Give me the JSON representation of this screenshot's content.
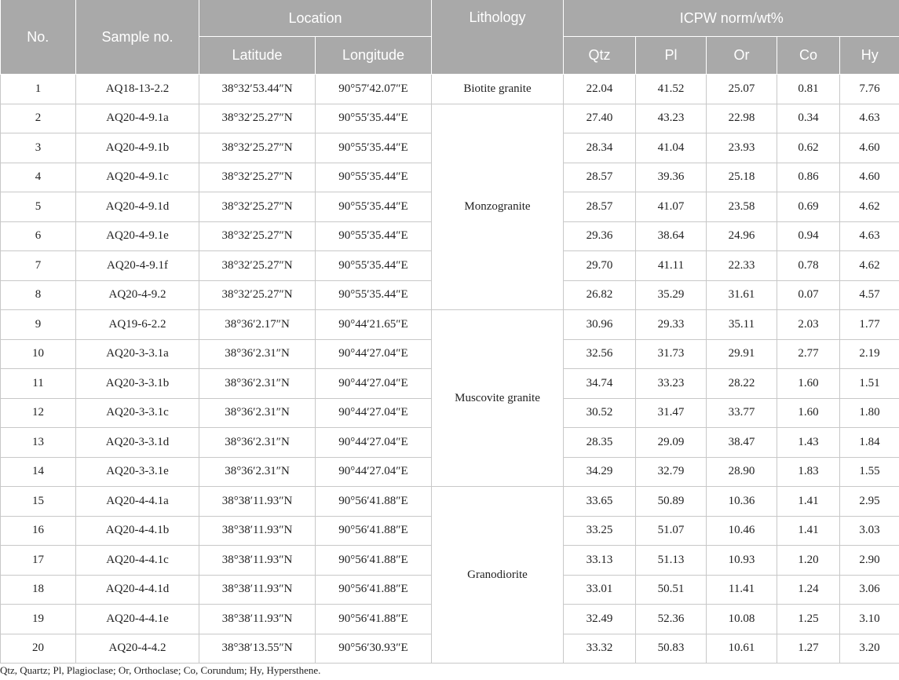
{
  "headers": {
    "no": "No.",
    "sample_no": "Sample no.",
    "location": "Location",
    "latitude": "Latitude",
    "longitude": "Longitude",
    "lithology": "Lithology",
    "icpw": "ICPW norm/wt%",
    "qtz": "Qtz",
    "pl": "Pl",
    "or": "Or",
    "co": "Co",
    "hy": "Hy"
  },
  "rows": [
    {
      "no": "1",
      "sample": "AQ18-13-2.2",
      "lat": "38°32′53.44″N",
      "lon": "90°57′42.07″E",
      "qtz": "22.04",
      "pl": "41.52",
      "or": "25.07",
      "co": "0.81",
      "hy": "7.76"
    },
    {
      "no": "2",
      "sample": "AQ20-4-9.1a",
      "lat": "38°32′25.27″N",
      "lon": "90°55′35.44″E",
      "qtz": "27.40",
      "pl": "43.23",
      "or": "22.98",
      "co": "0.34",
      "hy": "4.63"
    },
    {
      "no": "3",
      "sample": "AQ20-4-9.1b",
      "lat": "38°32′25.27″N",
      "lon": "90°55′35.44″E",
      "qtz": "28.34",
      "pl": "41.04",
      "or": "23.93",
      "co": "0.62",
      "hy": "4.60"
    },
    {
      "no": "4",
      "sample": "AQ20-4-9.1c",
      "lat": "38°32′25.27″N",
      "lon": "90°55′35.44″E",
      "qtz": "28.57",
      "pl": "39.36",
      "or": "25.18",
      "co": "0.86",
      "hy": "4.60"
    },
    {
      "no": "5",
      "sample": "AQ20-4-9.1d",
      "lat": "38°32′25.27″N",
      "lon": "90°55′35.44″E",
      "qtz": "28.57",
      "pl": "41.07",
      "or": "23.58",
      "co": "0.69",
      "hy": "4.62"
    },
    {
      "no": "6",
      "sample": "AQ20-4-9.1e",
      "lat": "38°32′25.27″N",
      "lon": "90°55′35.44″E",
      "qtz": "29.36",
      "pl": "38.64",
      "or": "24.96",
      "co": "0.94",
      "hy": "4.63"
    },
    {
      "no": "7",
      "sample": "AQ20-4-9.1f",
      "lat": "38°32′25.27″N",
      "lon": "90°55′35.44″E",
      "qtz": "29.70",
      "pl": "41.11",
      "or": "22.33",
      "co": "0.78",
      "hy": "4.62"
    },
    {
      "no": "8",
      "sample": "AQ20-4-9.2",
      "lat": "38°32′25.27″N",
      "lon": "90°55′35.44″E",
      "qtz": "26.82",
      "pl": "35.29",
      "or": "31.61",
      "co": "0.07",
      "hy": "4.57"
    },
    {
      "no": "9",
      "sample": "AQ19-6-2.2",
      "lat": "38°36′2.17″N",
      "lon": "90°44′21.65″E",
      "qtz": "30.96",
      "pl": "29.33",
      "or": "35.11",
      "co": "2.03",
      "hy": "1.77"
    },
    {
      "no": "10",
      "sample": "AQ20-3-3.1a",
      "lat": "38°36′2.31″N",
      "lon": "90°44′27.04″E",
      "qtz": "32.56",
      "pl": "31.73",
      "or": "29.91",
      "co": "2.77",
      "hy": "2.19"
    },
    {
      "no": "11",
      "sample": "AQ20-3-3.1b",
      "lat": "38°36′2.31″N",
      "lon": "90°44′27.04″E",
      "qtz": "34.74",
      "pl": "33.23",
      "or": "28.22",
      "co": "1.60",
      "hy": "1.51"
    },
    {
      "no": "12",
      "sample": "AQ20-3-3.1c",
      "lat": "38°36′2.31″N",
      "lon": "90°44′27.04″E",
      "qtz": "30.52",
      "pl": "31.47",
      "or": "33.77",
      "co": "1.60",
      "hy": "1.80"
    },
    {
      "no": "13",
      "sample": "AQ20-3-3.1d",
      "lat": "38°36′2.31″N",
      "lon": "90°44′27.04″E",
      "qtz": "28.35",
      "pl": "29.09",
      "or": "38.47",
      "co": "1.43",
      "hy": "1.84"
    },
    {
      "no": "14",
      "sample": "AQ20-3-3.1e",
      "lat": "38°36′2.31″N",
      "lon": "90°44′27.04″E",
      "qtz": "34.29",
      "pl": "32.79",
      "or": "28.90",
      "co": "1.83",
      "hy": "1.55"
    },
    {
      "no": "15",
      "sample": "AQ20-4-4.1a",
      "lat": "38°38′11.93″N",
      "lon": "90°56′41.88″E",
      "qtz": "33.65",
      "pl": "50.89",
      "or": "10.36",
      "co": "1.41",
      "hy": "2.95"
    },
    {
      "no": "16",
      "sample": "AQ20-4-4.1b",
      "lat": "38°38′11.93″N",
      "lon": "90°56′41.88″E",
      "qtz": "33.25",
      "pl": "51.07",
      "or": "10.46",
      "co": "1.41",
      "hy": "3.03"
    },
    {
      "no": "17",
      "sample": "AQ20-4-4.1c",
      "lat": "38°38′11.93″N",
      "lon": "90°56′41.88″E",
      "qtz": "33.13",
      "pl": "51.13",
      "or": "10.93",
      "co": "1.20",
      "hy": "2.90"
    },
    {
      "no": "18",
      "sample": "AQ20-4-4.1d",
      "lat": "38°38′11.93″N",
      "lon": "90°56′41.88″E",
      "qtz": "33.01",
      "pl": "50.51",
      "or": "11.41",
      "co": "1.24",
      "hy": "3.06"
    },
    {
      "no": "19",
      "sample": "AQ20-4-4.1e",
      "lat": "38°38′11.93″N",
      "lon": "90°56′41.88″E",
      "qtz": "32.49",
      "pl": "52.36",
      "or": "10.08",
      "co": "1.25",
      "hy": "3.10"
    },
    {
      "no": "20",
      "sample": "AQ20-4-4.2",
      "lat": "38°38′13.55″N",
      "lon": "90°56′30.93″E",
      "qtz": "33.32",
      "pl": "50.83",
      "or": "10.61",
      "co": "1.27",
      "hy": "3.20"
    }
  ],
  "lithology_groups": [
    {
      "label": "Biotite granite",
      "start": 0,
      "span": 1
    },
    {
      "label": "Monzogranite",
      "start": 1,
      "span": 7
    },
    {
      "label": "Muscovite granite",
      "start": 8,
      "span": 6
    },
    {
      "label": "Granodiorite",
      "start": 14,
      "span": 6
    }
  ],
  "footnote": "Qtz, Quartz; Pl, Plagioclase; Or, Orthoclase; Co, Corundum; Hy, Hypersthene."
}
